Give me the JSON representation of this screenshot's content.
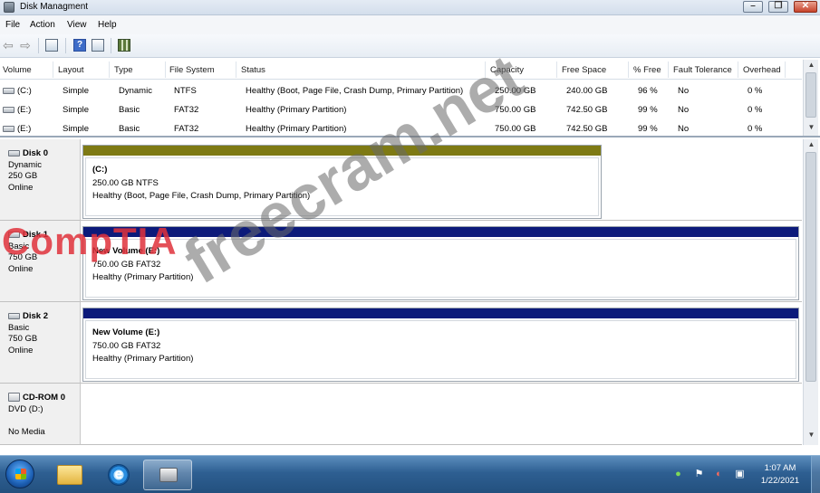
{
  "window": {
    "title": "Disk Managment",
    "controls": {
      "minimize": "–",
      "maximize": "❐",
      "close": "✕"
    }
  },
  "menu": [
    "File",
    "Action",
    "View",
    "Help"
  ],
  "toolbar": {
    "icons": [
      "back-icon",
      "forward-icon",
      "properties-icon",
      "help-icon",
      "show-hide-pane-icon",
      "disk-map-icon"
    ],
    "back_glyph": "⇦",
    "forward_glyph": "⇨",
    "help_glyph": "?"
  },
  "volume_table": {
    "columns": [
      "Volume",
      "Layout",
      "Type",
      "File System",
      "Status",
      "Capacity",
      "Free Space",
      "% Free",
      "Fault Tolerance",
      "Overhead"
    ],
    "rows": [
      {
        "volume": "(C:)",
        "layout": "Simple",
        "type": "Dynamic",
        "fs": "NTFS",
        "status": "Healthy (Boot, Page File, Crash Dump, Primary Partition)",
        "capacity": "250.00 GB",
        "free": "240.00 GB",
        "pct": "96 %",
        "fault": "No",
        "overhead": "0 %"
      },
      {
        "volume": "(E:)",
        "layout": "Simple",
        "type": "Basic",
        "fs": "FAT32",
        "status": "Healthy (Primary Partition)",
        "capacity": "750.00 GB",
        "free": "742.50 GB",
        "pct": "99 %",
        "fault": "No",
        "overhead": "0 %"
      },
      {
        "volume": "(E:)",
        "layout": "Simple",
        "type": "Basic",
        "fs": "FAT32",
        "status": "Healthy (Primary Partition)",
        "capacity": "750.00 GB",
        "free": "742.50 GB",
        "pct": "99 %",
        "fault": "No",
        "overhead": "0 %"
      }
    ]
  },
  "disks": [
    {
      "name": "Disk 0",
      "type": "Dynamic",
      "size": "250 GB",
      "state": "Online",
      "partition": {
        "title": "(C:)",
        "size_fs": "250.00 GB  NTFS",
        "status": "Healthy (Boot, Page File, Crash Dump, Primary Partition)",
        "bar_color": "#7e7a14"
      }
    },
    {
      "name": "Disk 1",
      "type": "Basic",
      "size": "750 GB",
      "state": "Online",
      "partition": {
        "title": "New Volume (E:)",
        "size_fs": "750.00 GB  FAT32",
        "status": "Healthy (Primary Partition)",
        "bar_color": "#0c1a7a"
      }
    },
    {
      "name": "Disk 2",
      "type": "Basic",
      "size": "750 GB",
      "state": "Online",
      "partition": {
        "title": "New Volume (E:)",
        "size_fs": "750.00 GB  FAT32",
        "status": "Healthy (Primary Partition)",
        "bar_color": "#0c1a7a"
      }
    },
    {
      "name": "CD-ROM 0",
      "type": "DVD (D:)",
      "state": "No Media"
    }
  ],
  "watermarks": {
    "brand": "CompTIA",
    "site": "freecram.net"
  },
  "taskbar": {
    "pinned": [
      "windows-explorer",
      "internet-explorer",
      "disk-management"
    ],
    "ie_glyph": "e",
    "tray": {
      "icons": [
        "network-icon",
        "action-center-flag-icon",
        "volume-muted-icon",
        "display-icon"
      ],
      "time": "1:07 AM",
      "date": "1/22/2021"
    }
  },
  "scroll": {
    "up": "▲",
    "down": "▼"
  },
  "colors": {
    "taskbar": "#2e5f92",
    "simple_volume_bar": "#7e7a14",
    "primary_partition_bar": "#0c1a7a"
  }
}
